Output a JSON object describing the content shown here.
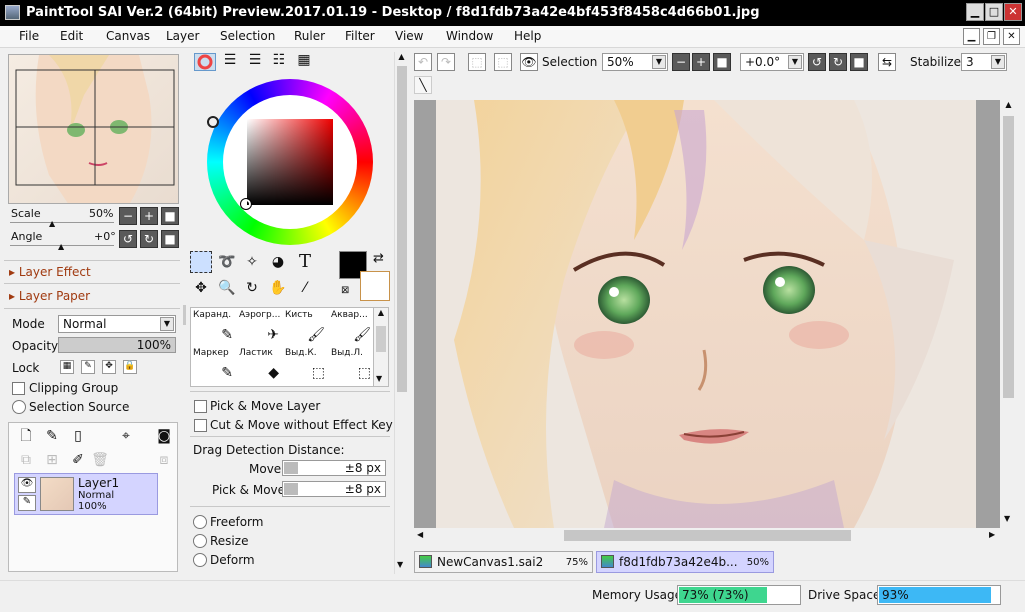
{
  "window": {
    "title": "PaintTool SAI Ver.2 (64bit) Preview.2017.01.19 - Desktop / f8d1fdb73a42e4bf453f8458c4d66b01.jpg",
    "minimize": "▁",
    "maximize": "□",
    "close": "✕"
  },
  "menu": [
    "File",
    "Edit",
    "Canvas",
    "Layer",
    "Selection",
    "Ruler",
    "Filter",
    "View",
    "Window",
    "Help"
  ],
  "menu_controls": {
    "minimize": "▁",
    "restore": "❐",
    "close": "✕"
  },
  "navigator": {
    "scale_label": "Scale",
    "scale_value": "50%",
    "angle_label": "Angle",
    "angle_value": "+0°"
  },
  "sections": {
    "layer_effect": "Layer Effect",
    "layer_paper": "Layer Paper"
  },
  "layer_props": {
    "mode_label": "Mode",
    "mode_value": "Normal",
    "opacity_label": "Opacity",
    "opacity_value": "100%",
    "lock_label": "Lock",
    "clipping_group": "Clipping Group",
    "selection_source": "Selection Source"
  },
  "layers": [
    {
      "name": "Layer1",
      "mode": "Normal",
      "opacity": "100%"
    }
  ],
  "brushes": [
    {
      "name": "Каранд.",
      "icon": "✎"
    },
    {
      "name": "Аэрогр...",
      "icon": "✈"
    },
    {
      "name": "Кисть",
      "icon": "🖌"
    },
    {
      "name": "Аквар...",
      "icon": "🖌"
    },
    {
      "name": "Маркер",
      "icon": "✎"
    },
    {
      "name": "Ластик",
      "icon": "◆"
    },
    {
      "name": "Выд.К.",
      "icon": "⬚"
    },
    {
      "name": "Выд.Л.",
      "icon": "⬚"
    }
  ],
  "move_options": {
    "pick_move_layer": "Pick & Move Layer",
    "cut_move": "Cut & Move without Effect Key",
    "drag_detection": "Drag Detection Distance:",
    "move_label": "Move",
    "move_value": "±8 px",
    "pick_label": "Pick & Move",
    "pick_value": "±8 px",
    "freeform": "Freeform",
    "resize": "Resize",
    "deform": "Deform"
  },
  "toolbar": {
    "selection_label": "Selection",
    "zoom_value": "50%",
    "angle_value": "+0.0°",
    "stabilizer_label": "Stabilizer",
    "stabilizer_value": "3"
  },
  "tabs": [
    {
      "name": "NewCanvas1.sai2",
      "zoom": "75%"
    },
    {
      "name": "f8d1fdb73a42e4b...",
      "zoom": "50%"
    }
  ],
  "status": {
    "memory_label": "Memory Usage",
    "memory_value": "73% (73%)",
    "memory_fill": 0.73,
    "drive_label": "Drive Space",
    "drive_value": "93%",
    "drive_fill": 0.93
  },
  "colors": {
    "memory_bar": "#3ed68f",
    "drive_bar": "#3db8f5",
    "title_bg": "#000000",
    "primary": "#000000",
    "secondary": "#ffffff"
  }
}
